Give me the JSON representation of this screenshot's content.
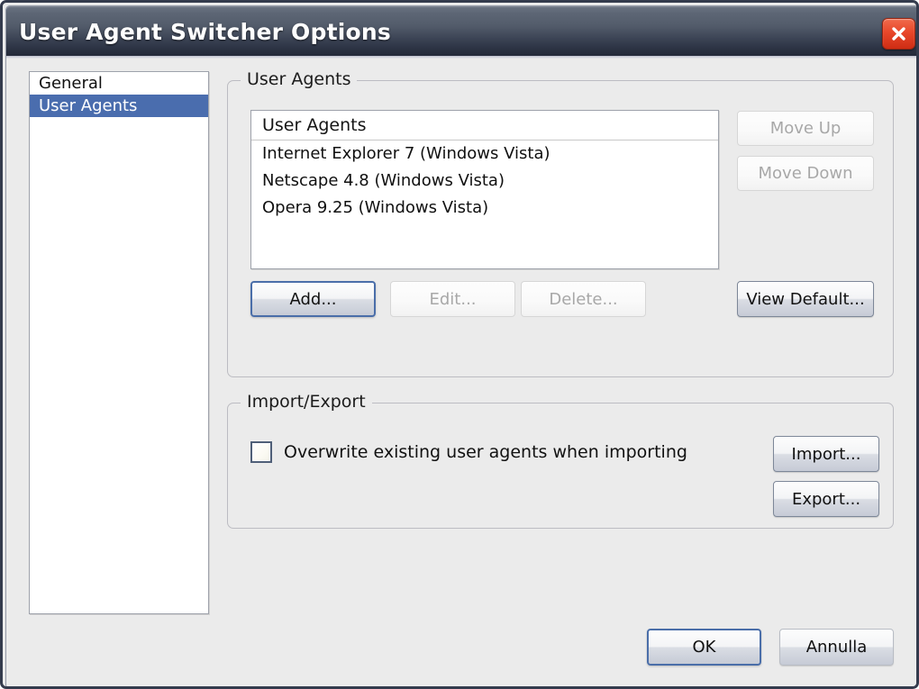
{
  "window": {
    "title": "User Agent Switcher Options",
    "close_icon": "close-icon",
    "accent_color": "#4a6dae",
    "titlebar_color": "#2b3243",
    "close_button_color": "#e8472a",
    "dialog_background": "#ebebeb"
  },
  "sidebar": {
    "items": [
      {
        "label": "General",
        "selected": false
      },
      {
        "label": "User Agents",
        "selected": true
      }
    ]
  },
  "user_agents_group": {
    "title": "User Agents",
    "list": {
      "header": "User Agents",
      "rows": [
        "Internet Explorer 7 (Windows Vista)",
        "Netscape 4.8 (Windows Vista)",
        "Opera 9.25 (Windows Vista)"
      ]
    },
    "buttons": {
      "move_up": "Move Up",
      "move_down": "Move Down",
      "add": "Add...",
      "edit": "Edit...",
      "delete": "Delete...",
      "view_default": "View Default..."
    }
  },
  "import_export_group": {
    "title": "Import/Export",
    "overwrite_label": "Overwrite existing user agents when importing",
    "overwrite_checked": false,
    "buttons": {
      "import": "Import...",
      "export": "Export..."
    }
  },
  "footer": {
    "ok": "OK",
    "cancel": "Annulla"
  }
}
